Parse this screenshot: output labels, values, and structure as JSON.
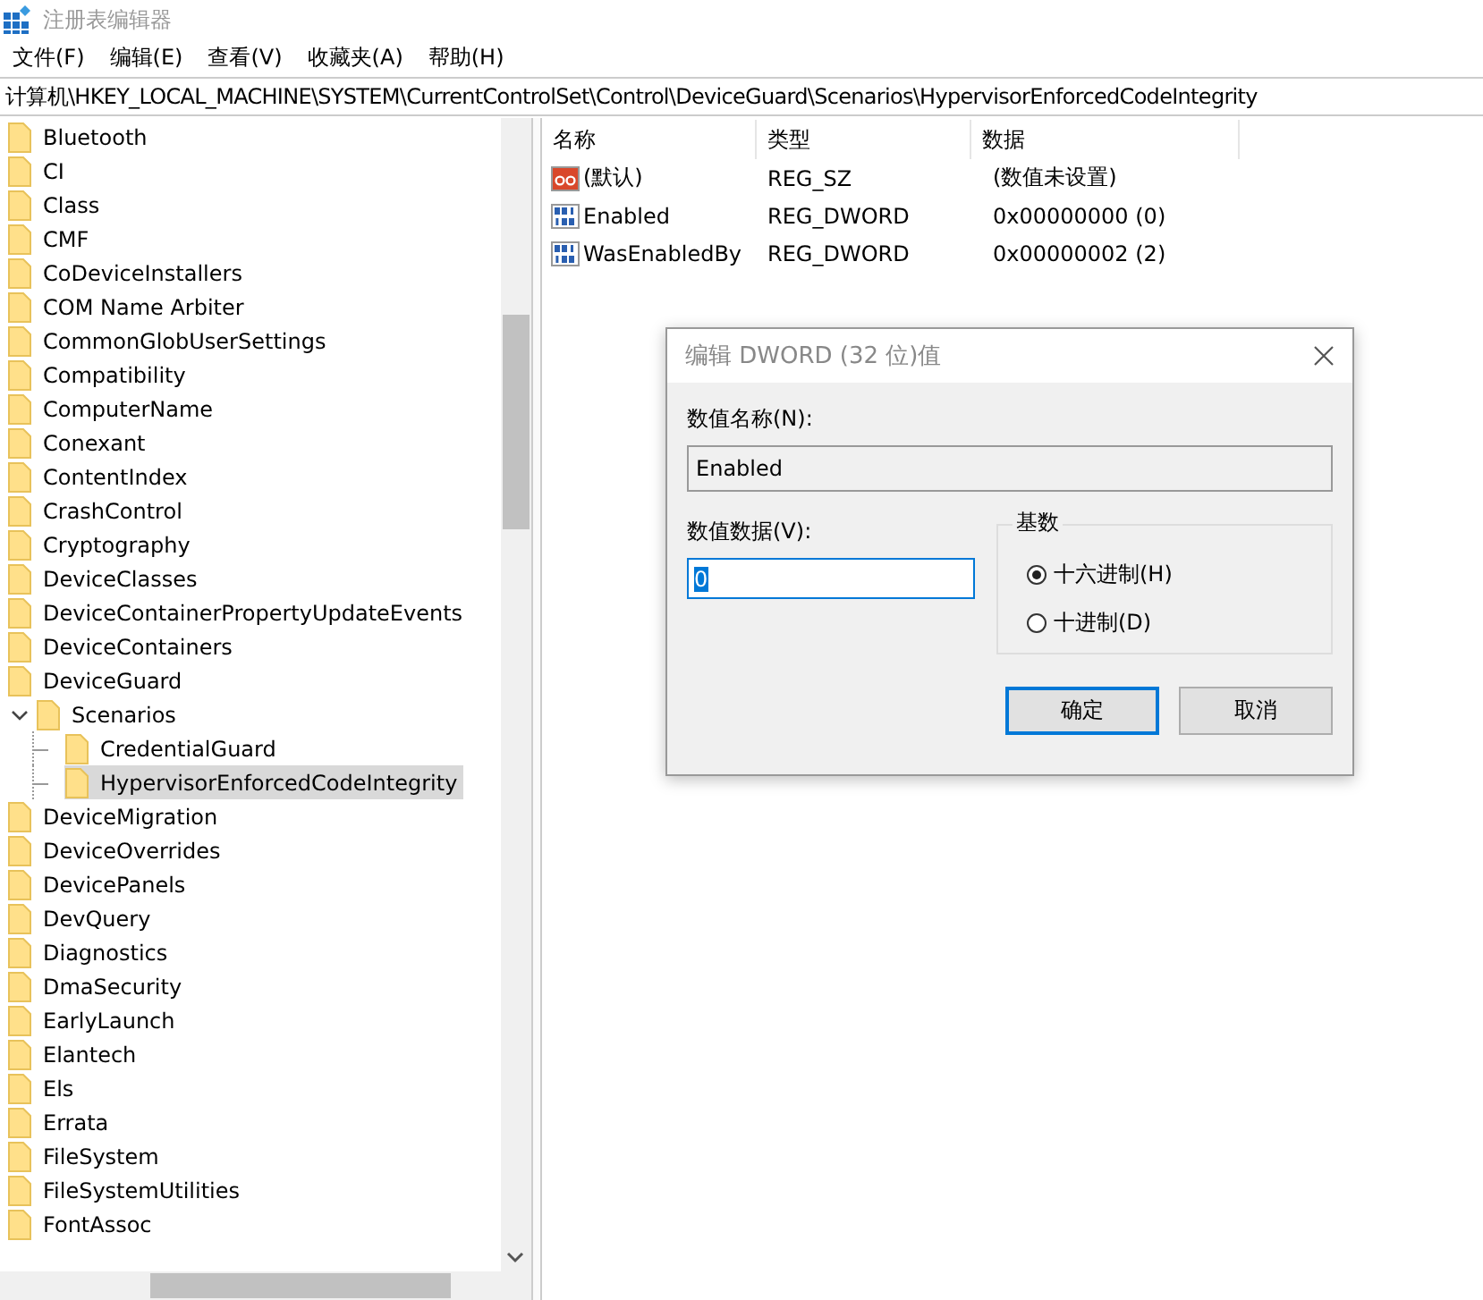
{
  "window": {
    "title": "注册表编辑器"
  },
  "menu": [
    "文件(F)",
    "编辑(E)",
    "查看(V)",
    "收藏夹(A)",
    "帮助(H)"
  ],
  "address": "计算机\\HKEY_LOCAL_MACHINE\\SYSTEM\\CurrentControlSet\\Control\\DeviceGuard\\Scenarios\\HypervisorEnforcedCodeIntegrity",
  "tree": [
    {
      "label": "Bluetooth",
      "selected": false
    },
    {
      "label": "CI",
      "selected": false
    },
    {
      "label": "Class",
      "selected": false
    },
    {
      "label": "CMF",
      "selected": false
    },
    {
      "label": "CoDeviceInstallers",
      "selected": false
    },
    {
      "label": "COM Name Arbiter",
      "selected": false
    },
    {
      "label": "CommonGlobUserSettings",
      "selected": false
    },
    {
      "label": "Compatibility",
      "selected": false
    },
    {
      "label": "ComputerName",
      "selected": false
    },
    {
      "label": "Conexant",
      "selected": false
    },
    {
      "label": "ContentIndex",
      "selected": false
    },
    {
      "label": "CrashControl",
      "selected": false
    },
    {
      "label": "Cryptography",
      "selected": false
    },
    {
      "label": "DeviceClasses",
      "selected": false
    },
    {
      "label": "DeviceContainerPropertyUpdateEvents",
      "selected": false
    },
    {
      "label": "DeviceContainers",
      "selected": false
    },
    {
      "label": "DeviceGuard",
      "selected": false,
      "children": [
        {
          "label": "Scenarios",
          "selected": false,
          "expanded": true,
          "children": [
            {
              "label": "CredentialGuard",
              "selected": false
            },
            {
              "label": "HypervisorEnforcedCodeIntegrity",
              "selected": true
            }
          ]
        }
      ]
    },
    {
      "label": "DeviceMigration",
      "selected": false
    },
    {
      "label": "DeviceOverrides",
      "selected": false
    },
    {
      "label": "DevicePanels",
      "selected": false
    },
    {
      "label": "DevQuery",
      "selected": false
    },
    {
      "label": "Diagnostics",
      "selected": false
    },
    {
      "label": "DmaSecurity",
      "selected": false
    },
    {
      "label": "EarlyLaunch",
      "selected": false
    },
    {
      "label": "Elantech",
      "selected": false
    },
    {
      "label": "Els",
      "selected": false
    },
    {
      "label": "Errata",
      "selected": false
    },
    {
      "label": "FileSystem",
      "selected": false
    },
    {
      "label": "FileSystemUtilities",
      "selected": false
    },
    {
      "label": "FontAssoc",
      "selected": false
    }
  ],
  "values": {
    "columns": [
      "名称",
      "类型",
      "数据"
    ],
    "rows": [
      {
        "kind": "string",
        "name": "(默认)",
        "type": "REG_SZ",
        "data": "(数值未设置)"
      },
      {
        "kind": "binary",
        "name": "Enabled",
        "type": "REG_DWORD",
        "data": "0x00000000 (0)"
      },
      {
        "kind": "binary",
        "name": "WasEnabledBy",
        "type": "REG_DWORD",
        "data": "0x00000002 (2)"
      }
    ]
  },
  "dialog": {
    "title": "编辑 DWORD (32 位)值",
    "name_label": "数值名称(N):",
    "name_value": "Enabled",
    "data_label": "数值数据(V):",
    "data_value": "0",
    "base_label": "基数",
    "bases": [
      {
        "label": "十六进制(H)",
        "selected": true
      },
      {
        "label": "十进制(D)",
        "selected": false
      }
    ],
    "buttons": [
      {
        "label": "确定",
        "default": true
      },
      {
        "label": "取消",
        "default": false
      }
    ]
  }
}
